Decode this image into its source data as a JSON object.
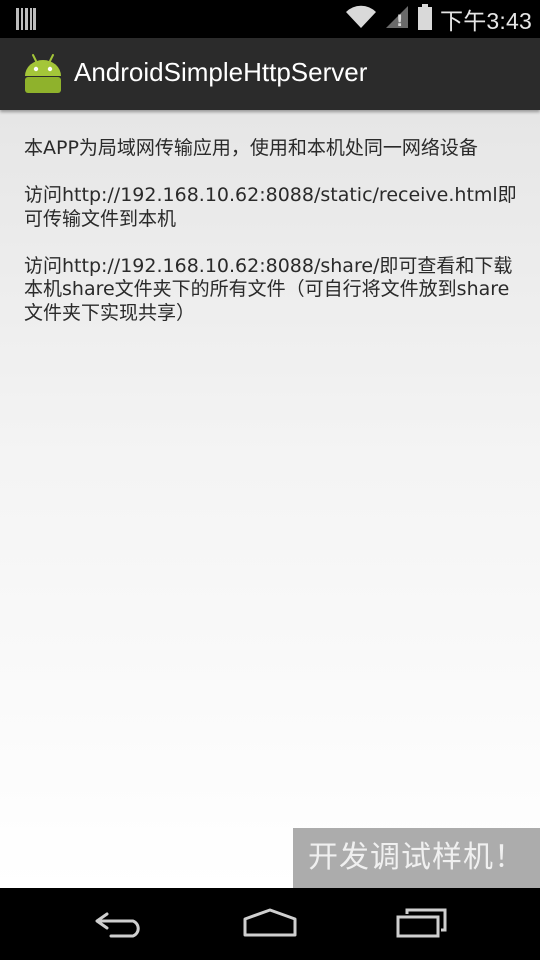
{
  "status_bar": {
    "time": "下午3:43",
    "icons": [
      "barcode-icon",
      "wifi-icon",
      "signal-icon",
      "battery-icon"
    ]
  },
  "action_bar": {
    "icon": "android-robot-icon",
    "title": "AndroidSimpleHttpServer"
  },
  "content": {
    "paragraphs": [
      "本APP为局域网传输应用，使用和本机处同一网络设备",
      "访问http://192.168.10.62:8088/static/receive.html即可传输文件到本机",
      "访问http://192.168.10.62:8088/share/即可查看和下载本机share文件夹下的所有文件（可自行将文件放到share文件夹下实现共享）"
    ]
  },
  "watermark": "开发调试样机！",
  "nav_bar": {
    "buttons": [
      "back-icon",
      "home-icon",
      "recent-apps-icon"
    ]
  },
  "colors": {
    "status_bar": "#000000",
    "action_bar": "#2b2b2b",
    "android_green": "#a4c639",
    "text": "#2a2a2a"
  }
}
